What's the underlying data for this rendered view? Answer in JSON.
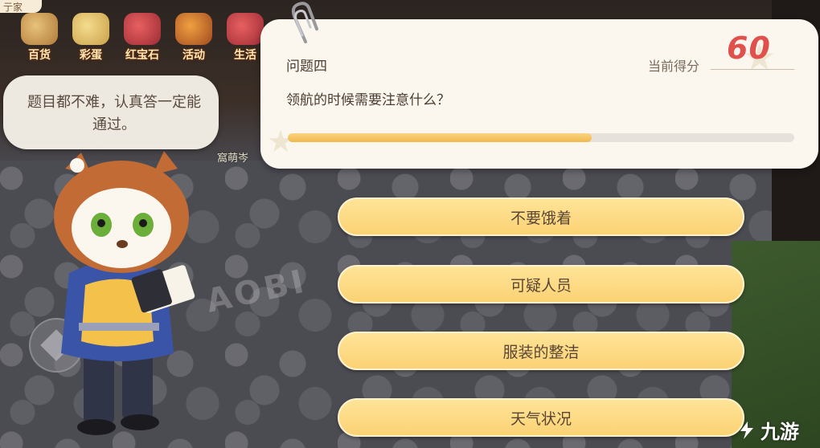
{
  "top_bar": {
    "corner_tab": "亍家",
    "icons": [
      {
        "label": "百货",
        "icon": "shop-icon"
      },
      {
        "label": "彩蛋",
        "icon": "egg-icon"
      },
      {
        "label": "红宝石",
        "icon": "ruby-icon"
      },
      {
        "label": "活动",
        "icon": "event-icon"
      },
      {
        "label": "生活",
        "icon": "life-icon"
      }
    ]
  },
  "scene": {
    "npc_name": "窩萌岑",
    "floor_logo": "AOBI"
  },
  "speech_bubble": {
    "text": "题目都不难，认真答一定能通过。"
  },
  "quiz": {
    "question_label": "问题四",
    "question_text": "领航的时候需要注意什么？",
    "score_label": "当前得分",
    "score_value": "60",
    "progress": 0.6,
    "progress_color": "#f0b84e",
    "score_color": "#e0504c"
  },
  "answers": [
    {
      "label": "不要饿着"
    },
    {
      "label": "可疑人员"
    },
    {
      "label": "服装的整洁"
    },
    {
      "label": "天气状况"
    }
  ],
  "watermark": {
    "text": "九游"
  },
  "colors": {
    "answer_bg": "#fbd274",
    "panel_bg": "#fbf7ee",
    "text_dark": "#4b3d33"
  }
}
